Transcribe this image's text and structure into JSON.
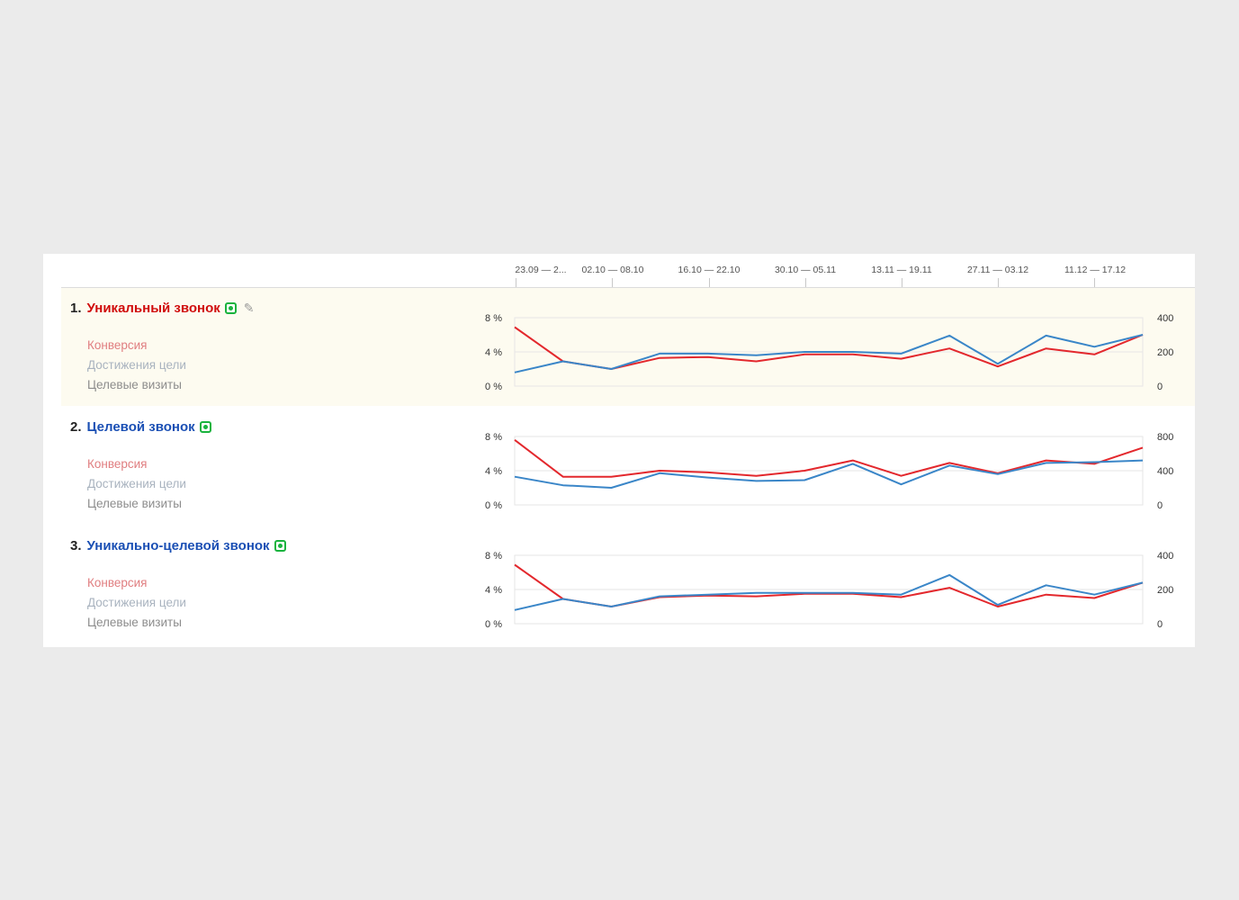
{
  "weeks": [
    "23.09 — 2...",
    "02.10 — 08.10",
    "16.10 — 22.10",
    "30.10 — 05.11",
    "13.11 — 19.11",
    "27.11 — 03.12",
    "11.12 — 17.12"
  ],
  "colors": {
    "conversion_line": "#e3282d",
    "visits_line": "#3a86c8",
    "grid": "#e6e6e6"
  },
  "metric_labels": {
    "conversion": "Конверсия",
    "goal_reaches": "Достижения цели",
    "target_visits": "Целевые визиты"
  },
  "goals": [
    {
      "number": "1.",
      "name": "Уникальный звонок",
      "icon": "phone-icon",
      "editable": true,
      "name_color": "#d00c0c"
    },
    {
      "number": "2.",
      "name": "Целевой звонок",
      "icon": "phone-icon",
      "editable": false,
      "name_color": "#1a4fb4"
    },
    {
      "number": "3.",
      "name": "Уникально-целевой звонок",
      "icon": "phone-icon",
      "editable": false,
      "name_color": "#1a4fb4"
    }
  ],
  "chart_data": [
    {
      "type": "line",
      "goal": "Уникальный звонок",
      "x_ticks": [
        "23.09 — 2...",
        "02.10 — 08.10",
        "16.10 — 22.10",
        "30.10 — 05.11",
        "13.11 — 19.11",
        "27.11 — 03.12",
        "11.12 — 17.12"
      ],
      "left_axis": {
        "ticks": [
          "0 %",
          "4 %",
          "8 %"
        ],
        "ylim": [
          0,
          8
        ]
      },
      "right_axis": {
        "ticks": [
          "0",
          "200",
          "400"
        ],
        "ylim": [
          0,
          400
        ]
      },
      "series": [
        {
          "axis": "left",
          "color": "#e3282d",
          "values": [
            6.9,
            2.9,
            2.0,
            3.3,
            3.4,
            2.9,
            3.7,
            3.7,
            3.2,
            4.4,
            2.3,
            4.4,
            3.7,
            6.0
          ]
        },
        {
          "axis": "right",
          "color": "#3a86c8",
          "values": [
            80,
            145,
            100,
            190,
            190,
            180,
            200,
            200,
            190,
            295,
            130,
            295,
            230,
            300
          ]
        }
      ],
      "grid": true
    },
    {
      "type": "line",
      "goal": "Целевой звонок",
      "x_ticks": [
        "23.09 — 2...",
        "02.10 — 08.10",
        "16.10 — 22.10",
        "30.10 — 05.11",
        "13.11 — 19.11",
        "27.11 — 03.12",
        "11.12 — 17.12"
      ],
      "left_axis": {
        "ticks": [
          "0 %",
          "4 %",
          "8 %"
        ],
        "ylim": [
          0,
          8
        ]
      },
      "right_axis": {
        "ticks": [
          "0",
          "400",
          "800"
        ],
        "ylim": [
          0,
          800
        ]
      },
      "series": [
        {
          "axis": "left",
          "color": "#e3282d",
          "values": [
            7.6,
            3.3,
            3.3,
            4.0,
            3.8,
            3.4,
            4.0,
            5.2,
            3.4,
            4.9,
            3.7,
            5.2,
            4.8,
            6.7
          ]
        },
        {
          "axis": "right",
          "color": "#3a86c8",
          "values": [
            330,
            230,
            200,
            370,
            320,
            280,
            290,
            480,
            240,
            460,
            360,
            490,
            500,
            520
          ]
        }
      ],
      "grid": true
    },
    {
      "type": "line",
      "goal": "Уникально-целевой звонок",
      "x_ticks": [
        "23.09 — 2...",
        "02.10 — 08.10",
        "16.10 — 22.10",
        "30.10 — 05.11",
        "13.11 — 19.11",
        "27.11 — 03.12",
        "11.12 — 17.12"
      ],
      "left_axis": {
        "ticks": [
          "0 %",
          "4 %",
          "8 %"
        ],
        "ylim": [
          0,
          8
        ]
      },
      "right_axis": {
        "ticks": [
          "0",
          "200",
          "400"
        ],
        "ylim": [
          0,
          400
        ]
      },
      "series": [
        {
          "axis": "left",
          "color": "#e3282d",
          "values": [
            6.9,
            2.9,
            2.0,
            3.1,
            3.3,
            3.2,
            3.5,
            3.5,
            3.1,
            4.2,
            2.0,
            3.4,
            3.0,
            4.8
          ]
        },
        {
          "axis": "right",
          "color": "#3a86c8",
          "values": [
            80,
            145,
            100,
            160,
            170,
            180,
            180,
            180,
            170,
            285,
            110,
            225,
            170,
            240
          ]
        }
      ],
      "grid": true
    }
  ]
}
